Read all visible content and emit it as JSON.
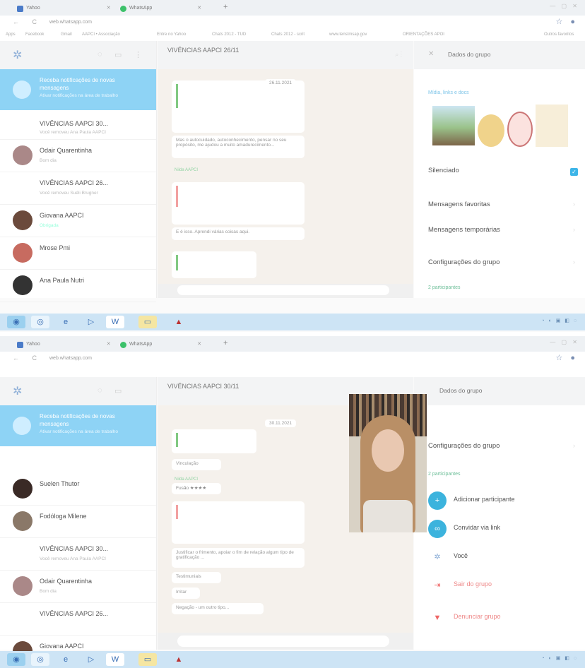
{
  "screens": [
    {
      "browser": {
        "tabs": [
          "Yahoo",
          "WhatsApp"
        ],
        "url": "web.whatsapp.com",
        "bookmarks": [
          "Apps",
          "Facebook",
          "Gmail",
          "AAPCI • Associação",
          "Entre no Yahoo",
          "Chats 2012 - TUD",
          "Chats 2012 - scrit",
          "www.tenstmsap.gov",
          "ORIENTAÇÕES APOI",
          "Outros favoritos"
        ]
      },
      "sidebar": {
        "notification": {
          "title": "Receba notificações de novas mensagens",
          "subtitle": "Ativar notificações na área de trabalho"
        },
        "chats": [
          {
            "name": "VIVÊNCIAS AAPCI 30...",
            "preview": "Você removeu Ana Paula AAPCI"
          },
          {
            "name": "Odair Quarentinha",
            "preview": "Bom dia"
          },
          {
            "name": "VIVÊNCIAS AAPCI 26...",
            "preview": "Você removeu Suéli Brugner"
          },
          {
            "name": "Giovana AAPCI",
            "preview": "Obrigada"
          },
          {
            "name": "Mrose Pmi",
            "preview": ""
          },
          {
            "name": "Ana Paula Nutri",
            "preview": ""
          }
        ]
      },
      "conversation": {
        "title": "VIVÊNCIAS AAPCI 26/11",
        "date": "26.11.2021",
        "messages": [
          "Mas o autocuidado, autoconhecimento, pensar no seu propósito, me ajudou a muito amadurecimento...",
          "E é isso. Aprendi várias coisas aqui."
        ],
        "senders": [
          "Nilda AAPCI"
        ]
      },
      "panel": {
        "title": "Dados do grupo",
        "media_label": "Mídia, links e docs",
        "rows": [
          "Silenciado",
          "Mensagens favoritas",
          "Mensagens temporárias",
          "Configurações do grupo"
        ],
        "participants_label": "2 participantes"
      }
    },
    {
      "browser": {
        "tabs": [
          "Yahoo",
          "WhatsApp"
        ],
        "url": "web.whatsapp.com"
      },
      "sidebar": {
        "notification": {
          "title": "Receba notificações de novas mensagens",
          "subtitle": "Ativar notificações na área de trabalho"
        },
        "chats": [
          {
            "name": "Suelen Thutor",
            "preview": ""
          },
          {
            "name": "Fodóloga Milene",
            "preview": ""
          },
          {
            "name": "VIVÊNCIAS AAPCI 30...",
            "preview": "Você removeu Ana Paula AAPCI"
          },
          {
            "name": "Odair Quarentinha",
            "preview": "Bom dia"
          },
          {
            "name": "VIVÊNCIAS AAPCI 26...",
            "preview": ""
          },
          {
            "name": "Giovana AAPCI",
            "preview": ""
          }
        ]
      },
      "conversation": {
        "title": "VIVÊNCIAS AAPCI 30/11",
        "date": "30.11.2021",
        "senders": [
          "Nilda AAPCI",
          "Nilda AAPCI"
        ],
        "messages": [
          "Vinculação",
          "Fusão ★★★★",
          "Justificar o frimento, apoiar o fim de relação algum tipo de gratificação ...",
          "Testimuniais",
          "Irritar",
          "Negação - um outro tipo..."
        ]
      },
      "panel": {
        "title": "Dados do grupo",
        "rows": [
          "Configurações do grupo"
        ],
        "participants_label": "2 participantes",
        "participants": [
          {
            "label": "Adicionar participante"
          },
          {
            "label": "Convidar via link"
          },
          {
            "label": "Você"
          }
        ],
        "actions": [
          "Sair do grupo",
          "Denunciar grupo"
        ]
      }
    }
  ]
}
